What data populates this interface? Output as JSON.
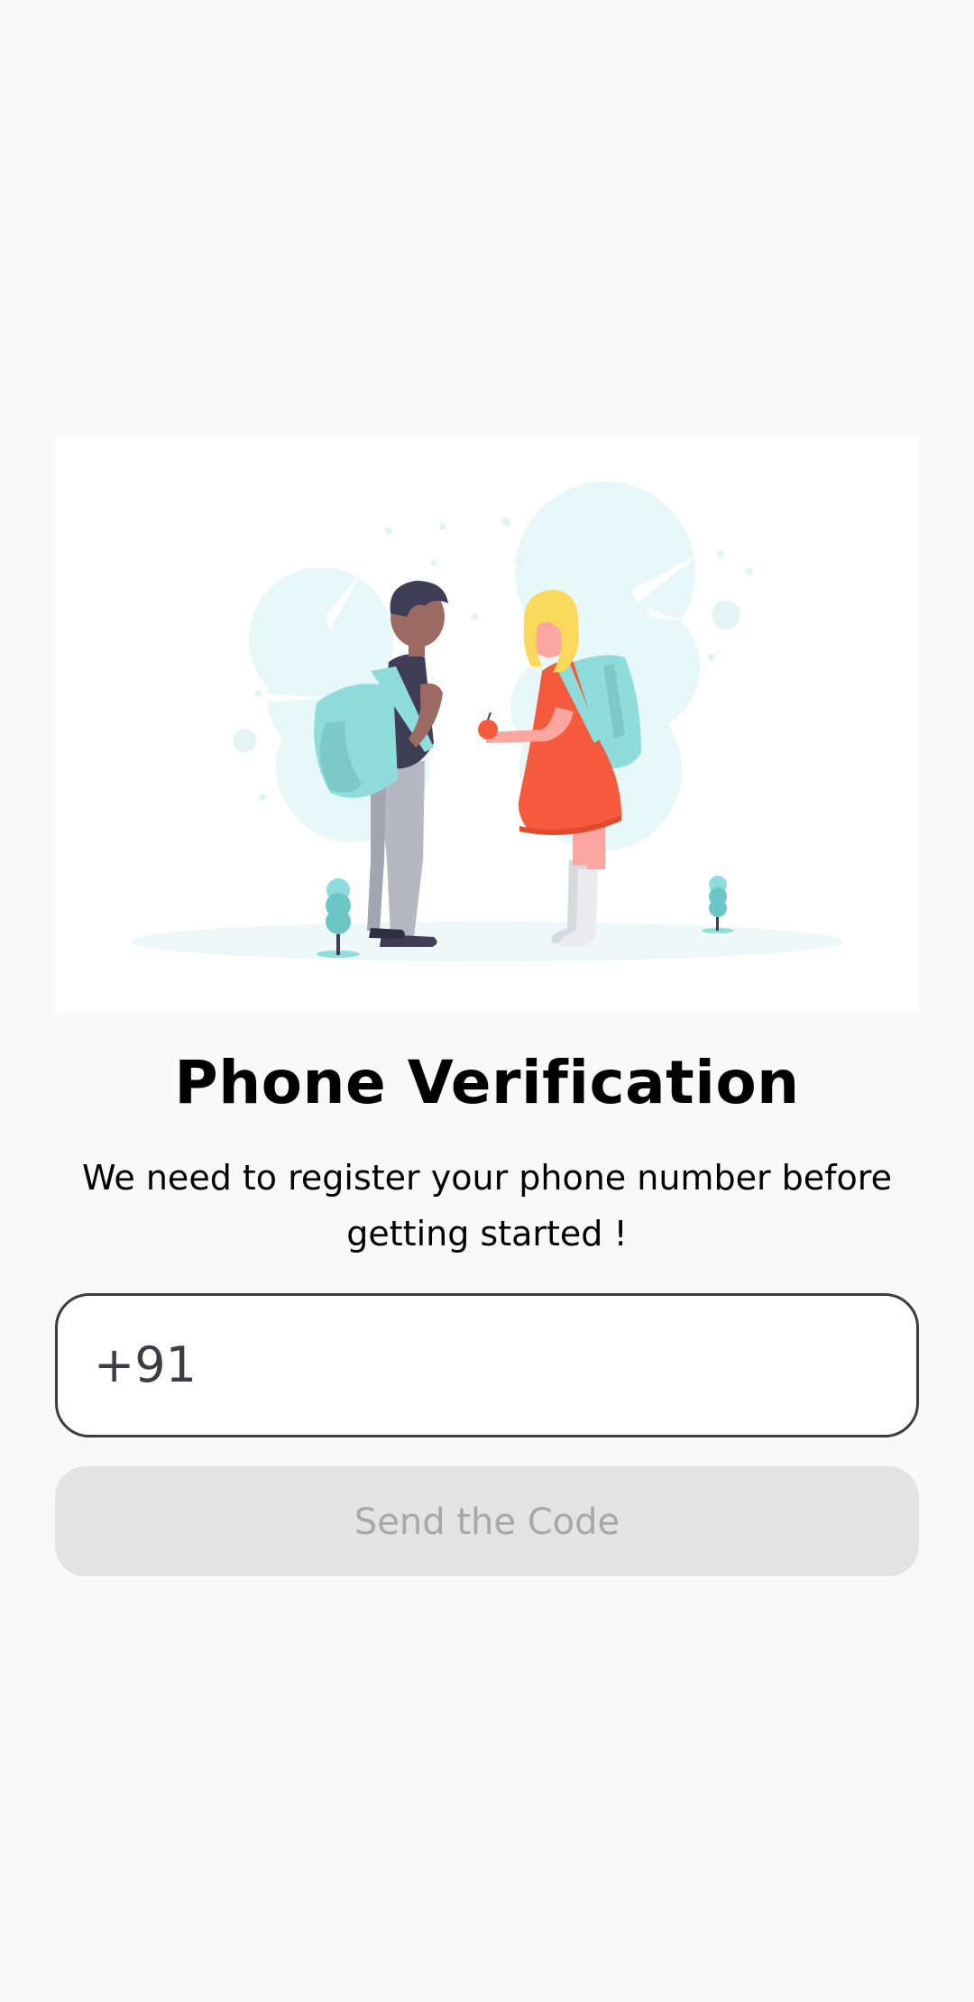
{
  "screen": {
    "title": "Phone Verification",
    "subtitle": "We need to register your phone number before getting started !"
  },
  "phone_field": {
    "country_code": "+91",
    "value": "",
    "placeholder": ""
  },
  "send_button": {
    "label": "Send the Code",
    "enabled": false
  },
  "colors": {
    "background": "#f9f9f9",
    "accent_teal": "#8fdcdc",
    "dress_red": "#f55a3c",
    "hair_blonde": "#f9d85a",
    "button_disabled_bg": "#e3e3e3",
    "button_disabled_text": "#a8a8a8",
    "field_border": "#3d3d3d"
  },
  "illustration": {
    "icon": "kids-with-backpacks-illustration"
  }
}
